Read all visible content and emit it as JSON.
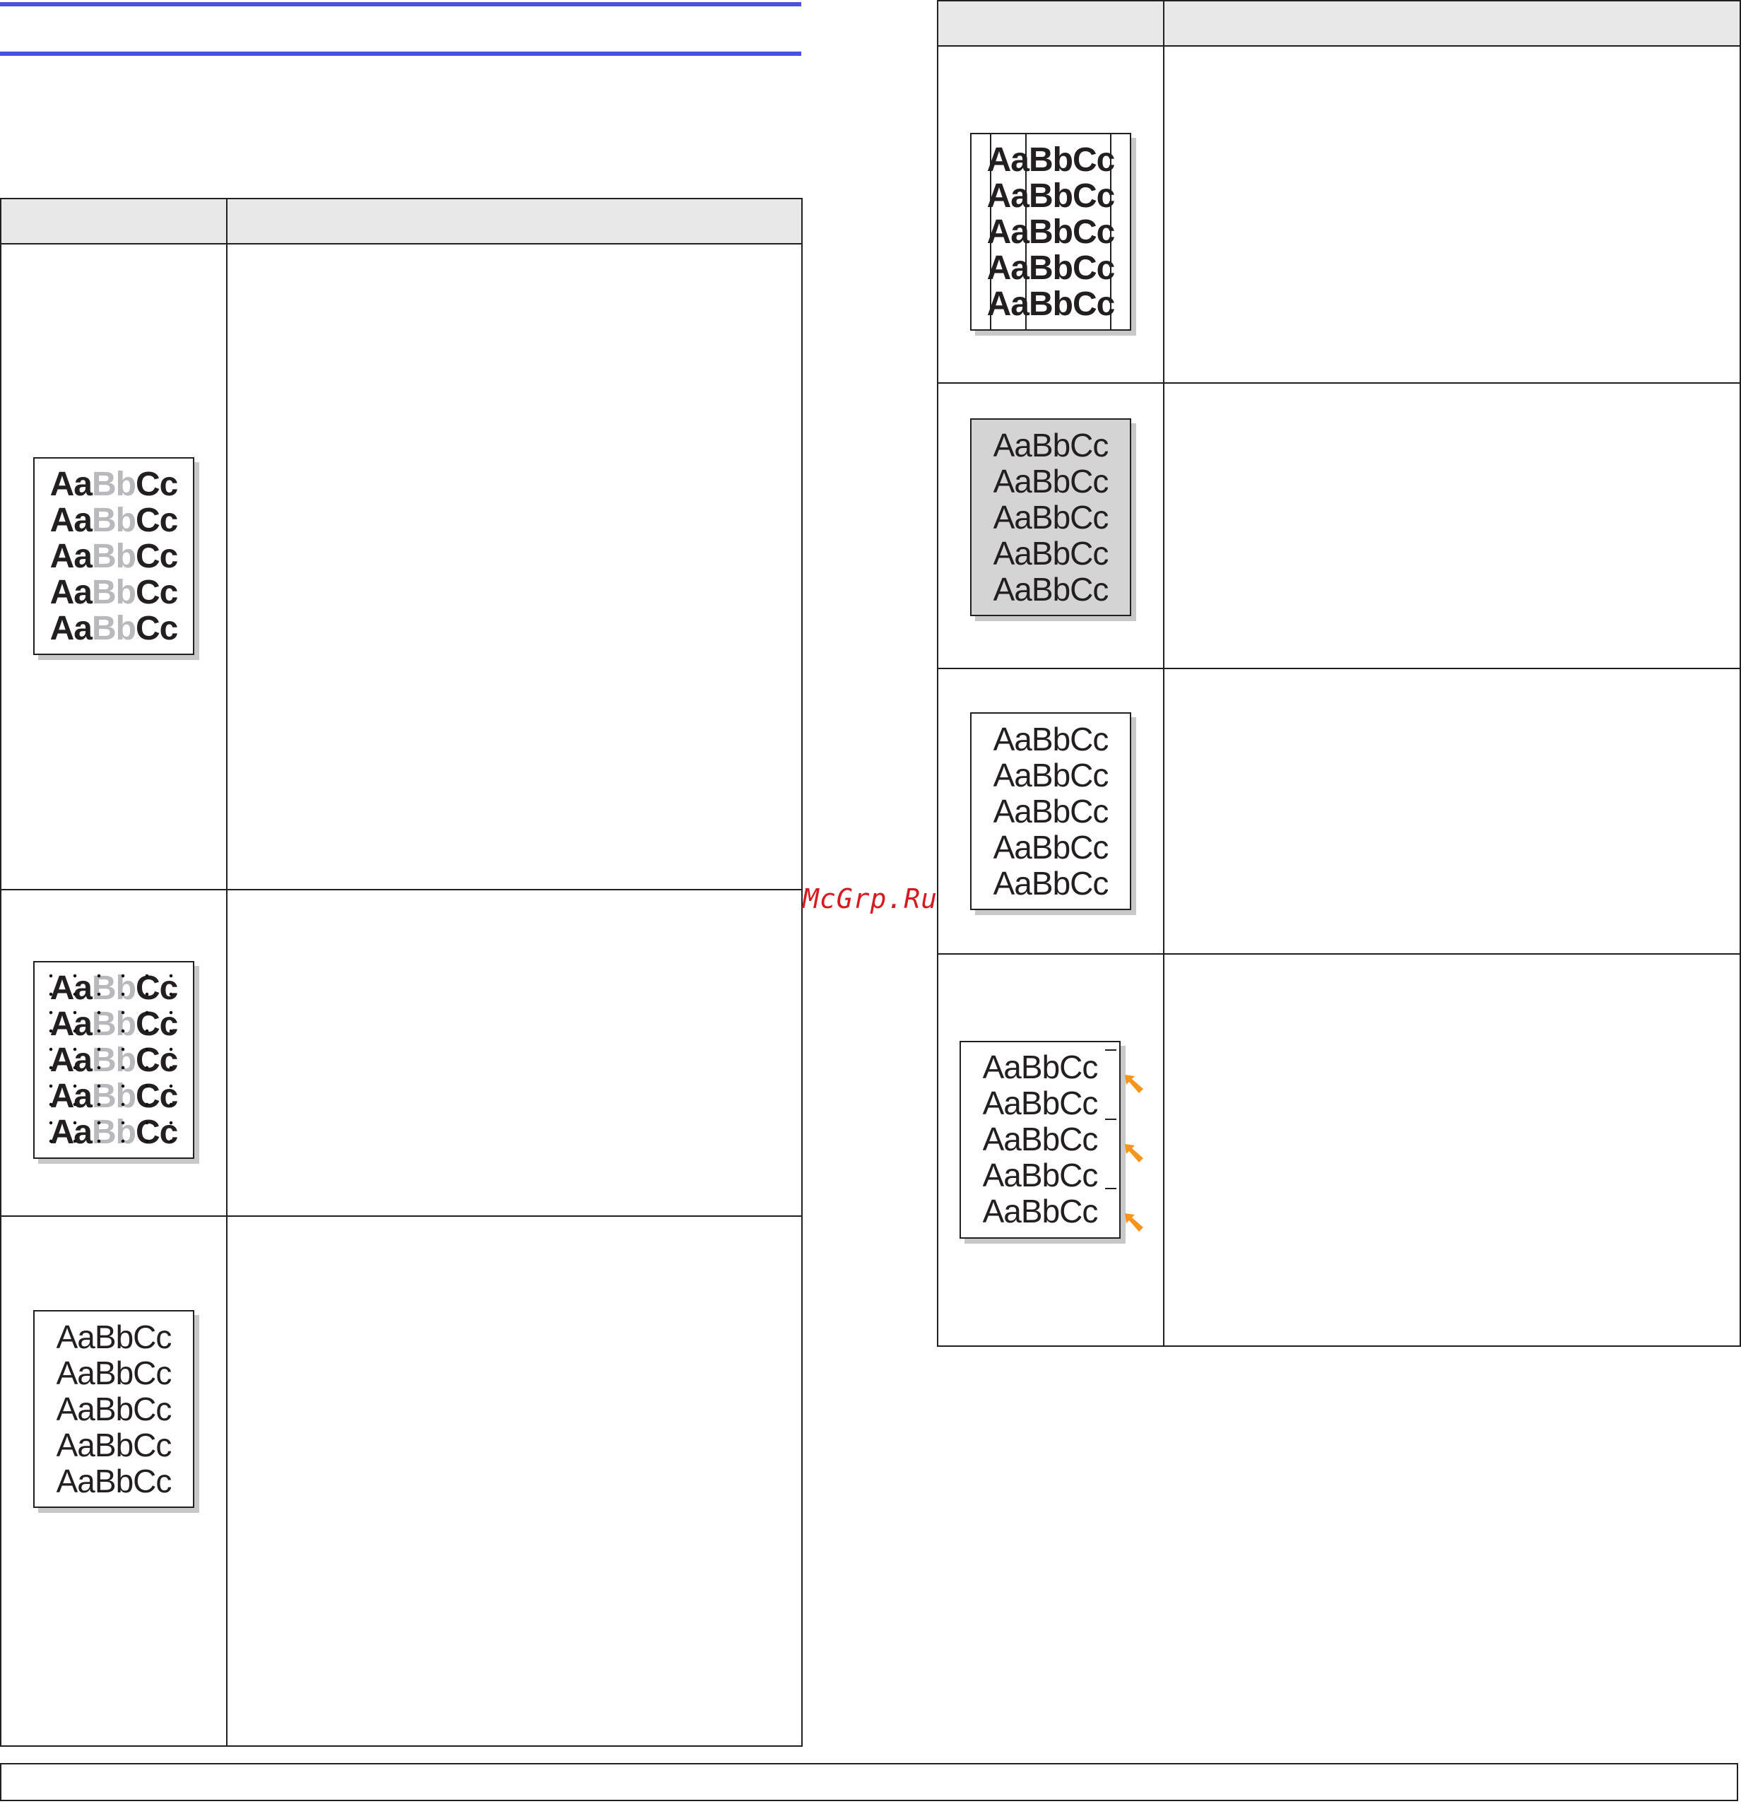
{
  "sample_text": "AaBbCc",
  "watermark": "McGrp.Ru",
  "colors": {
    "rule": "#4a50e0",
    "header_fill": "#e8e8e8",
    "faded": "#b8b8bd",
    "grey_page": "#d4d4d4",
    "arrow": "#f7941d"
  },
  "samples": {
    "light_print": {
      "lines": [
        [
          "Aa",
          "Bb",
          "Cc"
        ],
        [
          "Aa",
          "Bb",
          "Cc"
        ],
        [
          "Aa",
          "Bb",
          "Cc"
        ],
        [
          "Aa",
          "Bb",
          "Cc"
        ],
        [
          "Aa",
          "Bb",
          "Cc"
        ]
      ]
    },
    "toner_specks": {
      "lines": [
        [
          "Aa",
          "Bb",
          "Cc"
        ],
        [
          "Aa",
          "Bb",
          "Cc"
        ],
        [
          "Aa",
          "Bb",
          "Cc"
        ],
        [
          "Aa",
          "Bb",
          "Cc"
        ],
        [
          "Aa",
          "Bb",
          "Cc"
        ]
      ]
    },
    "dropouts": {
      "lines": [
        "AaBbCc",
        "AaBbCc",
        "AaBbCc",
        "AaBbCc",
        "AaBbCc"
      ]
    },
    "vertical_lines": {
      "lines": [
        "AaBbCc",
        "AaBbCc",
        "AaBbCc",
        "AaBbCc",
        "AaBbCc"
      ]
    },
    "grey_background": {
      "lines": [
        "AaBbCc",
        "AaBbCc",
        "AaBbCc",
        "AaBbCc",
        "AaBbCc"
      ]
    },
    "toner_smear": {
      "lines": [
        "AaBbCc",
        "AaBbCc",
        "AaBbCc",
        "AaBbCc",
        "AaBbCc"
      ]
    },
    "repeating_defects": {
      "lines": [
        "AaBbCc",
        "AaBbCc",
        "AaBbCc",
        "AaBbCc",
        "AaBbCc"
      ],
      "arrow_icon": "orange-arrow-icon"
    }
  }
}
